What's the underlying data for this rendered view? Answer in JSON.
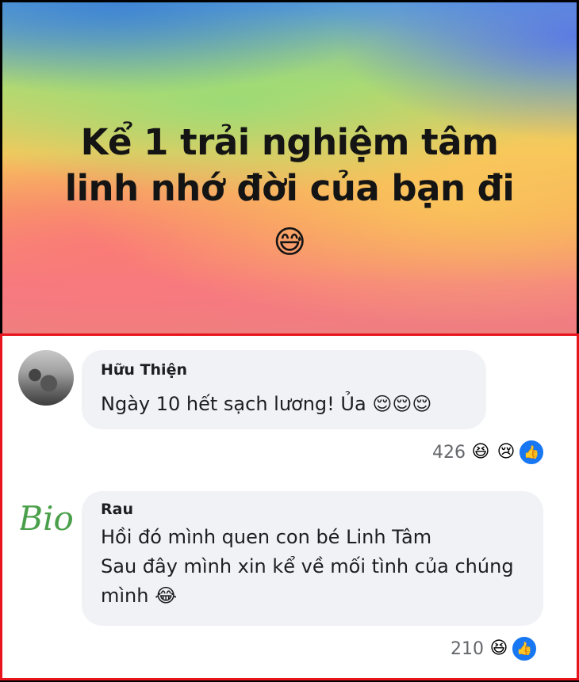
{
  "post": {
    "title_line1": "Kể 1 trải nghiệm tâm",
    "title_line2": "linh nhớ đời của bạn đi",
    "emoji": "😅"
  },
  "comments": [
    {
      "author": "Hữu Thiện",
      "lines": [
        "Ngày 10 hết sạch lương! Ủa 😌😌😌"
      ],
      "reaction_count": "426",
      "reactions": [
        "haha-icon",
        "sad-icon",
        "like-icon"
      ]
    },
    {
      "author": "Rau",
      "lines": [
        "Hồi đó mình quen con bé Linh Tâm",
        "Sau đây mình xin kể về mối tình của chúng",
        "mình 😂"
      ],
      "avatar_logo": "Bio",
      "reaction_count": "210",
      "reactions": [
        "haha-icon",
        "like-icon"
      ]
    }
  ],
  "colors": {
    "highlight_border": "#e8141b",
    "bubble_bg": "#f0f2f5",
    "like_blue": "#1877f2"
  }
}
